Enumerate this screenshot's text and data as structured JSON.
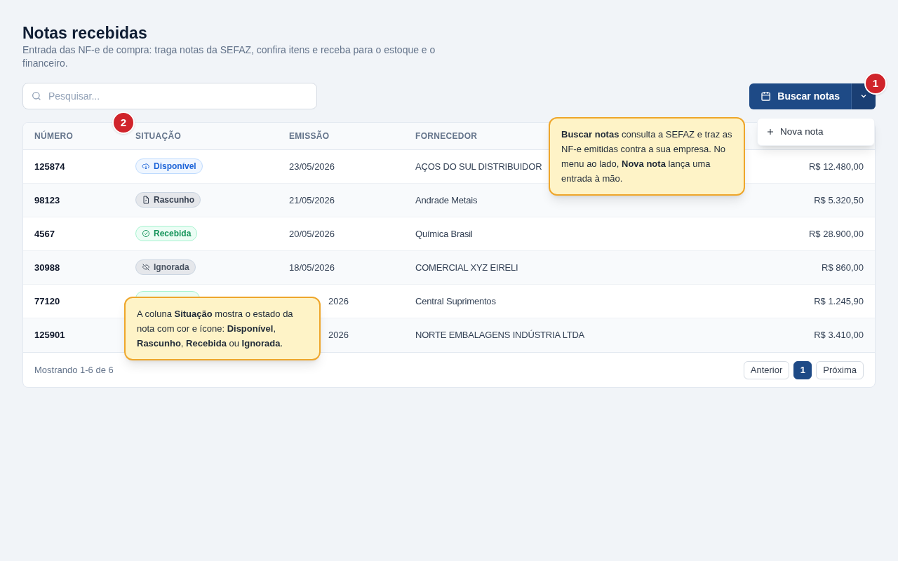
{
  "header": {
    "title": "Notas recebidas",
    "subtitle": "Entrada das NF-e de compra: traga notas da SEFAZ, confira itens e receba para o estoque e o financeiro."
  },
  "search": {
    "placeholder": "Pesquisar..."
  },
  "primary_button": {
    "label": "Buscar notas"
  },
  "dropdown_menu": {
    "expanded": true,
    "items": [
      {
        "label": "Nova nota"
      }
    ]
  },
  "table": {
    "columns": [
      "NÚMERO",
      "SITUAÇÃO",
      "EMISSÃO",
      "FORNECEDOR"
    ],
    "rows": [
      {
        "numero": "125874",
        "status": {
          "kind": "disponivel",
          "label": "Disponível"
        },
        "emissao": "23/05/2026",
        "fornecedor": "AÇOS DO SUL DISTRIBUIDOR",
        "valor": "R$ 12.480,00"
      },
      {
        "numero": "98123",
        "status": {
          "kind": "rascunho",
          "label": "Rascunho"
        },
        "emissao": "21/05/2026",
        "fornecedor": "Andrade Metais",
        "valor": "R$ 5.320,50"
      },
      {
        "numero": "4567",
        "status": {
          "kind": "recebida",
          "label": "Recebida"
        },
        "emissao": "20/05/2026",
        "fornecedor": "Química Brasil",
        "valor": "R$ 28.900,00"
      },
      {
        "numero": "30988",
        "status": {
          "kind": "ignorada",
          "label": "Ignorada"
        },
        "emissao": "18/05/2026",
        "fornecedor": "COMERCIAL XYZ EIRELI",
        "valor": "R$ 860,00"
      },
      {
        "numero": "77120",
        "status": {
          "kind": "recebida"
        },
        "emissao": "2026",
        "emissao_clipped": true,
        "fornecedor": "Central Suprimentos",
        "valor": "R$ 1.245,90"
      },
      {
        "numero": "125901",
        "emissao": "2026",
        "emissao_clipped": true,
        "fornecedor": "NORTE EMBALAGENS INDÚSTRIA LTDA",
        "valor": "R$ 3.410,00"
      }
    ]
  },
  "footer": {
    "summary": "Mostrando 1-6 de 6",
    "pagination": [
      {
        "label": "Anterior",
        "kind": "nav",
        "selected": false
      },
      {
        "label": "1",
        "kind": "page",
        "selected": true
      },
      {
        "label": "Próxima",
        "kind": "nav",
        "selected": false
      }
    ]
  },
  "tour_markers": [
    {
      "label": "1"
    },
    {
      "label": "2"
    }
  ],
  "tooltips": [
    {
      "text": "**Buscar notas** consulta a SEFAZ e traz as NF-e emitidas contra a sua empresa. No menu ao lado, **Nova nota** lança uma entrada à mão."
    },
    {
      "text": "A coluna **Situação** mostra o estado da nota com cor e ícone: **Disponível**, **Rascunho**, **Recebida** ou **Ignorada**."
    }
  ]
}
